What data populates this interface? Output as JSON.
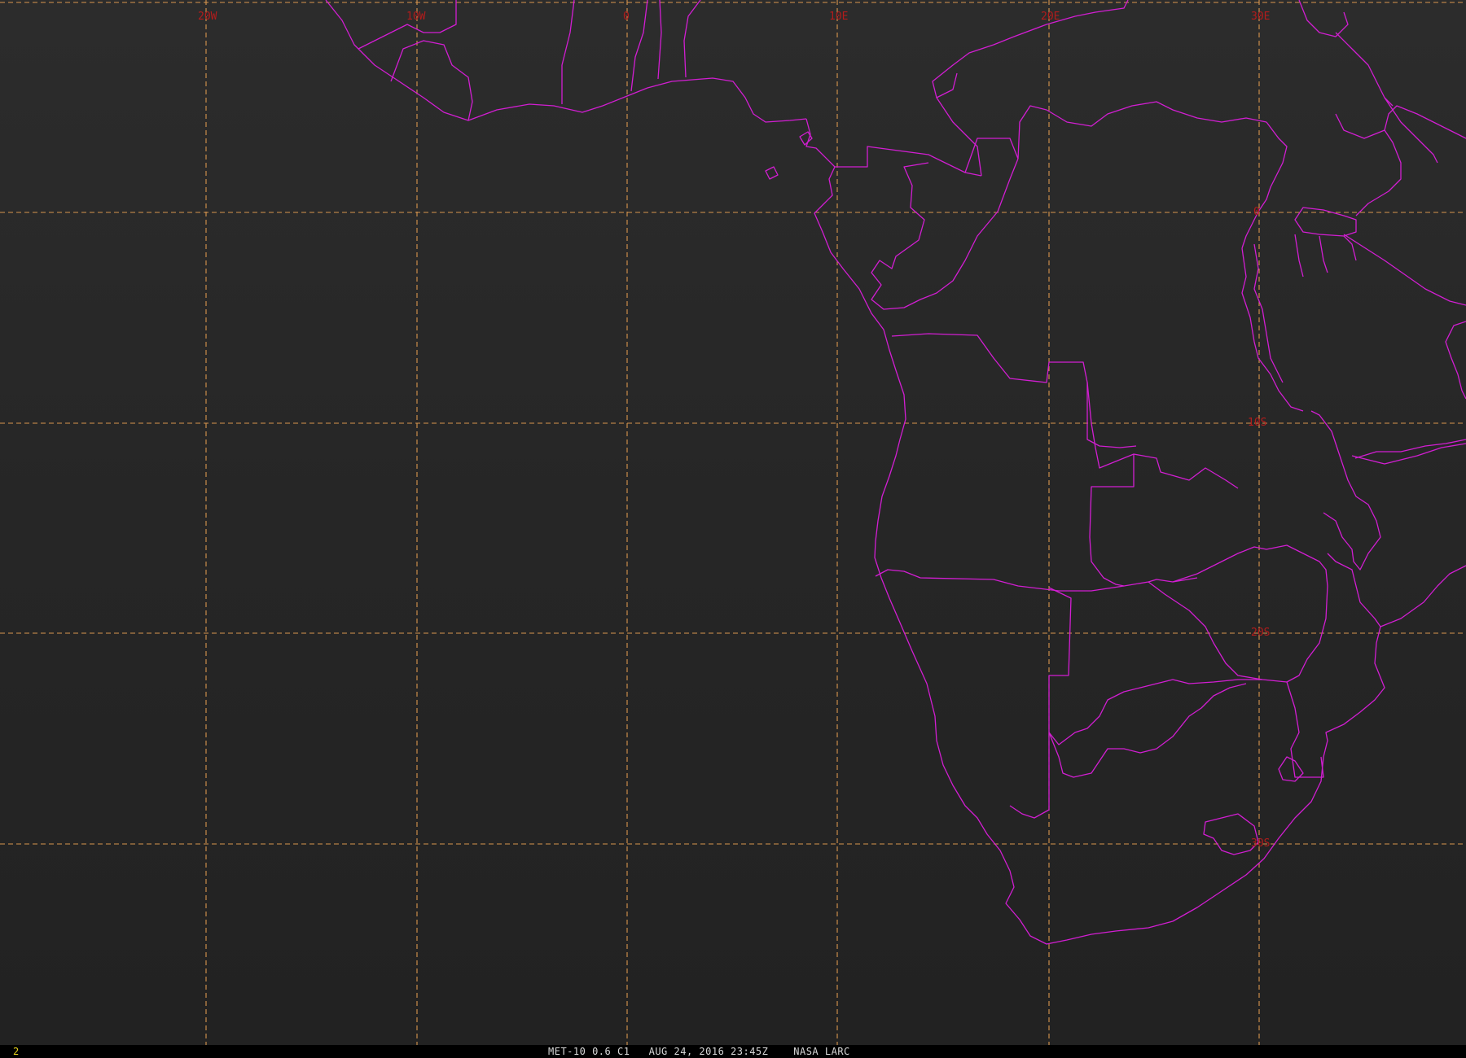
{
  "image": {
    "colors": {
      "background": "#252525",
      "coastline": "#d21ed2",
      "gridline": "#d9964e",
      "grid_label": "#b31c1c",
      "status_bar": "#000000",
      "frame_number": "#e6d21e"
    }
  },
  "grid": {
    "longitude_labels": [
      "20W",
      "10W",
      "0",
      "10E",
      "20E",
      "30E"
    ],
    "latitude_labels": [
      "0",
      "10S",
      "20S",
      "30S"
    ]
  },
  "status_bar": {
    "frame_number": "2",
    "caption": "MET-10 0.6 C1   AUG 24, 2016 23:45Z    NASA LARC"
  }
}
